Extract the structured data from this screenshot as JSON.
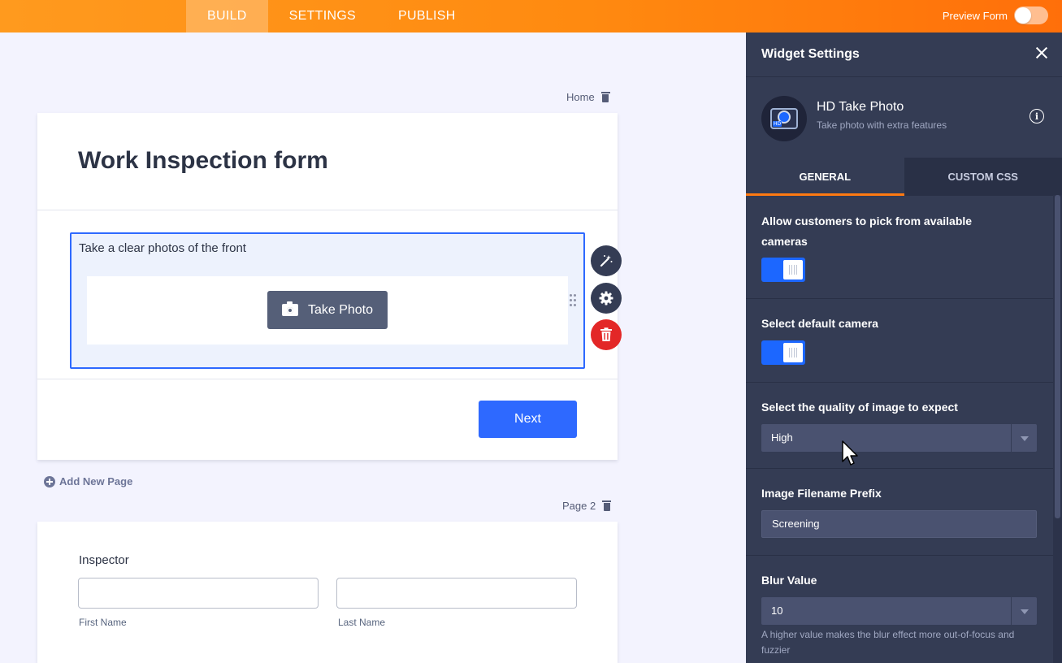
{
  "topbar": {
    "tabs": [
      {
        "label": "BUILD",
        "active": true
      },
      {
        "label": "SETTINGS",
        "active": false
      },
      {
        "label": "PUBLISH",
        "active": false
      }
    ],
    "preview_label": "Preview Form",
    "preview_on": false,
    "colors": {
      "orange_start": "#ff9a1e",
      "orange_end": "#ff6f0a"
    }
  },
  "canvas": {
    "page1_label": "Home",
    "form_title": "Work Inspection form",
    "photo_widget": {
      "label": "Take a clear photos of the front",
      "button_label": "Take Photo",
      "button_icon": "camera-icon"
    },
    "side_actions": [
      {
        "icon": "magic-wand-icon"
      },
      {
        "icon": "gear-icon"
      },
      {
        "icon": "trash-icon"
      }
    ],
    "next_label": "Next",
    "add_page_label": "Add New Page",
    "page2_label": "Page 2",
    "inspector": {
      "label": "Inspector",
      "first_name_label": "First Name",
      "last_name_label": "Last Name"
    },
    "colors": {
      "primary": "#2e69ff",
      "danger": "#e32727"
    }
  },
  "panel": {
    "title": "Widget Settings",
    "widget_name": "HD Take Photo",
    "widget_desc": "Take photo with extra features",
    "tabs": [
      {
        "label": "GENERAL",
        "active": true
      },
      {
        "label": "CUSTOM CSS",
        "active": false
      }
    ],
    "settings": {
      "pick_cameras": {
        "label": "Allow customers to pick from available cameras",
        "on": true
      },
      "default_camera": {
        "label": "Select default camera",
        "on": true
      },
      "quality": {
        "label": "Select the quality of image to expect",
        "value": "High"
      },
      "prefix": {
        "label": "Image Filename Prefix",
        "value": "Screening"
      },
      "blur": {
        "label": "Blur Value",
        "value": "10",
        "hint": "A higher value makes the blur effect more out-of-focus and fuzzier"
      }
    },
    "colors": {
      "bg": "#343c54",
      "accent": "#ff7a11",
      "toggle": "#1c67ff"
    }
  }
}
